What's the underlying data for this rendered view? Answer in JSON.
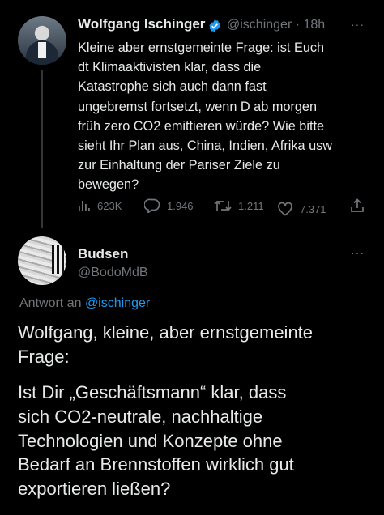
{
  "tweet1": {
    "author_name": "Wolfgang Ischinger",
    "handle_time": "@ischinger · 18h",
    "text": "Kleine aber ernstgemeinte Frage: ist Euch\ndt Klimaaktivisten klar, dass die\nKatastrophe sich auch dann fast\nungebremst fortsetzt, wenn D ab morgen\nfrüh zero CO2 emittieren würde? Wie bitte\nsieht Ihr Plan aus, China, Indien, Afrika usw\nzur Einhaltung der Pariser Ziele zu\nbewegen?",
    "views": "623K",
    "replies": "1.946",
    "retweets": "1.211",
    "likes": "7.371",
    "more_label": "···"
  },
  "tweet2": {
    "author_name": "Budsen",
    "handle": "@BodoMdB",
    "more_label": "···",
    "reply_to_prefix": "Antwort an",
    "reply_to_mention": "@ischinger",
    "paragraph1": "Wolfgang, kleine, aber ernstgemeinte\nFrage:",
    "paragraph2": "Ist Dir „Geschäftsmann“ klar, dass\nsich CO2-neutrale, nachhaltige\nTechnologien und Konzepte ohne\nBedarf an Brennstoffen wirklich gut\nexportieren ließen?"
  },
  "colors": {
    "background": "#000000",
    "text": "#e7e9ea",
    "secondary": "#71767b",
    "accent": "#1d9bf0"
  },
  "icons": [
    "verified-badge-icon",
    "views-icon",
    "reply-icon",
    "retweet-icon",
    "like-icon",
    "share-icon",
    "more-icon"
  ]
}
